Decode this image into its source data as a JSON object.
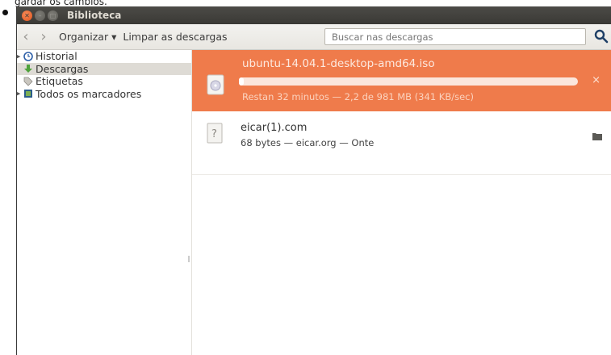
{
  "caption": "gardar os cambios.",
  "window": {
    "title": "Biblioteca"
  },
  "toolbar": {
    "back_label": "‹",
    "forward_label": "›",
    "organize_label": "Organizar ▾",
    "clear_label": "Limpar as descargas",
    "search_placeholder": "Buscar nas descargas"
  },
  "sidebar": {
    "items": [
      {
        "label": "Historial",
        "icon": "clock-icon"
      },
      {
        "label": "Descargas",
        "icon": "download-arrow-icon",
        "selected": true
      },
      {
        "label": "Etiquetas",
        "icon": "tag-icon"
      },
      {
        "label": "Todos os marcadores",
        "icon": "bookmarks-icon"
      }
    ]
  },
  "downloads": {
    "active": {
      "filename": "ubuntu-14.04.1-desktop-amd64.iso",
      "status": "Restan 32 minutos — 2,2 de 981 MB (341 KB/sec)",
      "progress": 0.002,
      "cancel_label": "×"
    },
    "completed": [
      {
        "filename": "eicar(1).com",
        "status": "68 bytes — eicar.org — Onte"
      }
    ]
  },
  "colors": {
    "accent": "#ef7b4b",
    "titlebar": "#3c3b37",
    "selected": "#dedbd5"
  }
}
